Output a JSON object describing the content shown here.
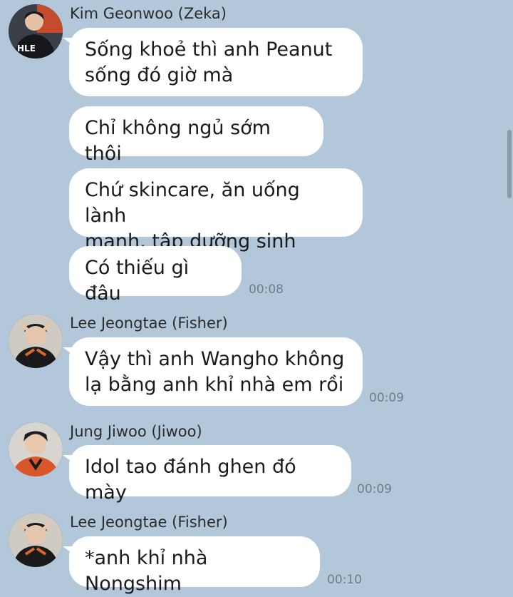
{
  "colors": {
    "background": "#b2c7d9",
    "bubble": "#ffffff",
    "timestamp": "#6f7d89"
  },
  "messages": [
    {
      "sender": "Kim Geonwoo (Zeka)",
      "avatar_icon": "profile-avatar-zeka",
      "bubbles": [
        "Sống khoẻ thì anh Peanut\nsống đó giờ mà",
        "Chỉ không ngủ sớm thôi",
        "Chứ skincare, ăn uống lành\nmạnh, tập dưỡng sinh",
        "Có thiếu gì đâu"
      ],
      "time": "00:08"
    },
    {
      "sender": "Lee Jeongtae (Fisher)",
      "avatar_icon": "profile-avatar-fisher",
      "bubbles": [
        "Vậy thì anh Wangho không\nlạ bằng anh khỉ nhà em rồi"
      ],
      "time": "00:09"
    },
    {
      "sender": "Jung Jiwoo (Jiwoo)",
      "avatar_icon": "profile-avatar-jiwoo",
      "bubbles": [
        "Idol tao đánh ghen đó mày"
      ],
      "time": "00:09"
    },
    {
      "sender": "Lee Jeongtae (Fisher)",
      "avatar_icon": "profile-avatar-fisher",
      "bubbles": [
        "*anh khỉ nhà Nongshim"
      ],
      "time": "00:10"
    }
  ]
}
